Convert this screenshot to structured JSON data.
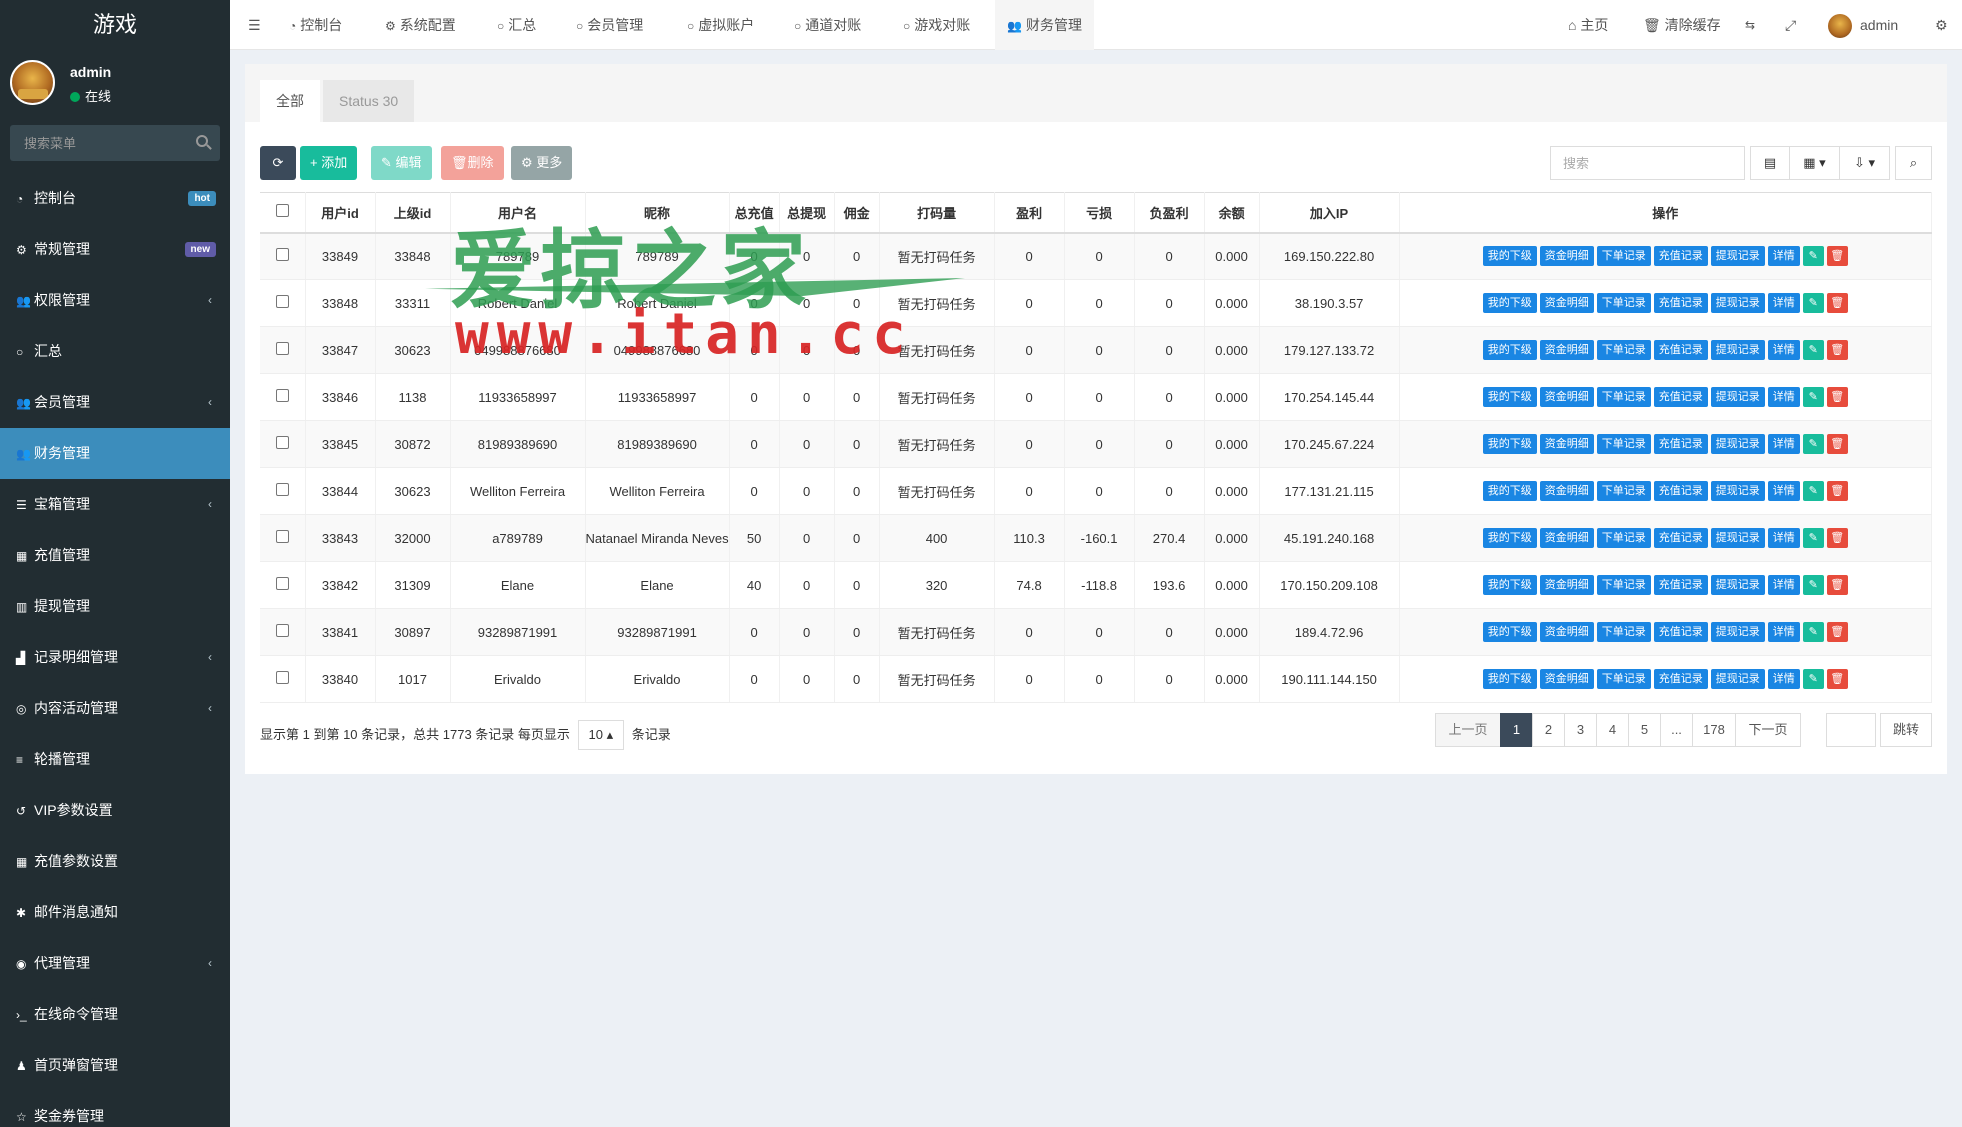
{
  "sidebar": {
    "brand": "游戏",
    "user": {
      "name": "admin",
      "status": "在线"
    },
    "search_placeholder": "搜索菜单",
    "items": [
      {
        "label": "控制台",
        "icon": "dashboard-icon",
        "badge": "hot"
      },
      {
        "label": "常规管理",
        "icon": "cogs-icon",
        "badge": "new"
      },
      {
        "label": "权限管理",
        "icon": "group-icon",
        "caret": true
      },
      {
        "label": "汇总",
        "icon": "circle-icon"
      },
      {
        "label": "会员管理",
        "icon": "group-icon",
        "caret": true
      },
      {
        "label": "财务管理",
        "icon": "group-icon",
        "active": true
      },
      {
        "label": "宝箱管理",
        "icon": "list-icon",
        "caret": true
      },
      {
        "label": "充值管理",
        "icon": "grid-icon"
      },
      {
        "label": "提现管理",
        "icon": "bars-icon"
      },
      {
        "label": "记录明细管理",
        "icon": "chart-icon",
        "caret": true
      },
      {
        "label": "内容活动管理",
        "icon": "dribbble-icon",
        "caret": true
      },
      {
        "label": "轮播管理",
        "icon": "menu-icon"
      },
      {
        "label": "VIP参数设置",
        "icon": "history-icon"
      },
      {
        "label": "充值参数设置",
        "icon": "th-icon"
      },
      {
        "label": "邮件消息通知",
        "icon": "asterisk-icon"
      },
      {
        "label": "代理管理",
        "icon": "user-circle-icon",
        "caret": true
      },
      {
        "label": "在线命令管理",
        "icon": "terminal-icon"
      },
      {
        "label": "首页弹窗管理",
        "icon": "bell-icon"
      },
      {
        "label": "奖金券管理",
        "icon": "star-icon"
      }
    ]
  },
  "navbar": {
    "tabs": [
      {
        "label": "控制台",
        "icon": "dashboard-icon"
      },
      {
        "label": "系统配置",
        "icon": "cog-icon"
      },
      {
        "label": "汇总",
        "icon": "circle-icon"
      },
      {
        "label": "会员管理",
        "icon": "circle-icon"
      },
      {
        "label": "虚拟账户",
        "icon": "circle-icon"
      },
      {
        "label": "通道对账",
        "icon": "circle-icon"
      },
      {
        "label": "游戏对账",
        "icon": "circle-icon"
      },
      {
        "label": "财务管理",
        "icon": "group-icon",
        "active": true
      }
    ],
    "home": "主页",
    "clear_cache": "清除缓存",
    "user": "admin"
  },
  "content": {
    "tabs": [
      "全部",
      "Status 30"
    ],
    "toolbar": {
      "add": "添加",
      "edit": "编辑",
      "delete": "删除",
      "more": "更多"
    },
    "search_placeholder": "搜索",
    "columns": [
      "用户id",
      "上级id",
      "用户名",
      "昵称",
      "总充值",
      "总提现",
      "佣金",
      "打码量",
      "盈利",
      "亏损",
      "负盈利",
      "余额",
      "加入IP",
      "操作"
    ],
    "actions": [
      "我的下级",
      "资金明细",
      "下单记录",
      "充值记录",
      "提现记录",
      "详情"
    ],
    "rows": [
      [
        "33849",
        "33848",
        "789789",
        "789789",
        "0",
        "0",
        "0",
        "暂无打码任务",
        "0",
        "0",
        "0",
        "0.000",
        "169.150.222.80"
      ],
      [
        "33848",
        "33311",
        "Robert Daniel",
        "Robert Daniel",
        "0",
        "0",
        "0",
        "暂无打码任务",
        "0",
        "0",
        "0",
        "0.000",
        "38.190.3.57"
      ],
      [
        "33847",
        "30623",
        "049988876680",
        "049988876680",
        "0",
        "0",
        "0",
        "暂无打码任务",
        "0",
        "0",
        "0",
        "0.000",
        "179.127.133.72"
      ],
      [
        "33846",
        "1138",
        "11933658997",
        "11933658997",
        "0",
        "0",
        "0",
        "暂无打码任务",
        "0",
        "0",
        "0",
        "0.000",
        "170.254.145.44"
      ],
      [
        "33845",
        "30872",
        "81989389690",
        "81989389690",
        "0",
        "0",
        "0",
        "暂无打码任务",
        "0",
        "0",
        "0",
        "0.000",
        "170.245.67.224"
      ],
      [
        "33844",
        "30623",
        "Welliton Ferreira",
        "Welliton Ferreira",
        "0",
        "0",
        "0",
        "暂无打码任务",
        "0",
        "0",
        "0",
        "0.000",
        "177.131.21.115"
      ],
      [
        "33843",
        "32000",
        "a789789",
        "Natanael Miranda Neves",
        "50",
        "0",
        "0",
        "400",
        "110.3",
        "-160.1",
        "270.4",
        "0.000",
        "45.191.240.168"
      ],
      [
        "33842",
        "31309",
        "Elane",
        "Elane",
        "40",
        "0",
        "0",
        "320",
        "74.8",
        "-118.8",
        "193.6",
        "0.000",
        "170.150.209.108"
      ],
      [
        "33841",
        "30897",
        "93289871991",
        "93289871991",
        "0",
        "0",
        "0",
        "暂无打码任务",
        "0",
        "0",
        "0",
        "0.000",
        "189.4.72.96"
      ],
      [
        "33840",
        "1017",
        "Erivaldo",
        "Erivaldo",
        "0",
        "0",
        "0",
        "暂无打码任务",
        "0",
        "0",
        "0",
        "0.000",
        "190.111.144.150"
      ]
    ],
    "pagination": {
      "summary_prefix": "显示第 1 到第 10 条记录，总共 1773 条记录 每页显示",
      "page_size": "10",
      "summary_suffix": "条记录",
      "prev": "上一页",
      "pages": [
        "1",
        "2",
        "3",
        "4",
        "5",
        "...",
        "178"
      ],
      "next": "下一页",
      "jump": "跳转"
    }
  },
  "watermark": {
    "text_cn": "爱掠之家",
    "text_url": "www.itan.cc"
  },
  "colors": {
    "sidebar_bg": "#222d32",
    "active_menu": "#3c8dbc",
    "add_btn": "#18bc9c",
    "delete_icon": "#e74c3c",
    "action_btn": "#1a86e3"
  }
}
